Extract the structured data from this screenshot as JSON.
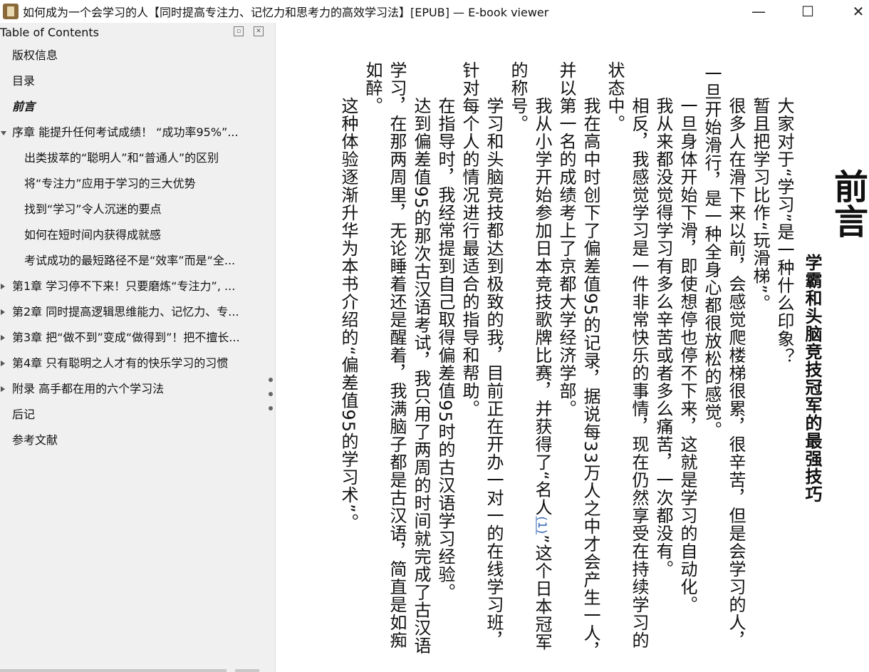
{
  "window": {
    "title": "如何成为一个会学习的人【同时提高专注力、记忆力和思考力的高效学习法】[EPUB] — E-book viewer",
    "minimize": "—",
    "maximize": "☐",
    "close": "✕"
  },
  "toc": {
    "title": "Table of Contents",
    "float_btn": "▫",
    "close_btn": "✕",
    "items": [
      {
        "label": "版权信息"
      },
      {
        "label": "目录"
      },
      {
        "label": "前言"
      },
      {
        "label": "序章 能提升任何考试成绩！ “成功率95%”..."
      },
      {
        "label": "出类拔萃的“聪明人”和“普通人”的区别"
      },
      {
        "label": "将“专注力”应用于学习的三大优势"
      },
      {
        "label": "找到“学习”令人沉迷的要点"
      },
      {
        "label": "如何在短时间内获得成就感"
      },
      {
        "label": "考试成功的最短路径不是“效率”而是“全..."
      },
      {
        "label": "第1章 学习停不下来！只要磨炼“专注力”, ..."
      },
      {
        "label": "第2章 同时提高逻辑思维能力、记忆力、专..."
      },
      {
        "label": "第3章 把“做不到”变成“做得到”！把不擅长..."
      },
      {
        "label": "第4章 只有聪明之人才有的快乐学习的习惯"
      },
      {
        "label": "附录 高手都在用的六个学习法"
      },
      {
        "label": "后记"
      },
      {
        "label": "参考文献"
      }
    ]
  },
  "book": {
    "chapter_title": "前言",
    "subtitle": "学霸和头脑竞技冠军的最强技巧",
    "columns": [
      "大家对于“学习”是一种什么印象？",
      "暂且把学习比作“玩滑梯”。",
      "很多人在滑下来以前，会感觉爬楼梯很累，很辛苦，但是会学习的人，",
      "一旦开始滑行，是一种全身心都很放松的感觉。",
      "一旦身体开始下滑，即使想停也停不下来，这就是学习的自动化。",
      "我从来都没觉得学习有多么辛苦或者多么痛苦，一次都没有。",
      "相反，我感觉学习是一件非常快乐的事情，现在仍然享受在持续学习的",
      "状态中。",
      "我在高中时创下了偏差值95的记录，据说每33万人之中才会产生一人，",
      "并以第一名的成绩考上了京都大学经济学部。",
      "我从小学开始参加日本竞技歌牌比赛，并获得了“名人",
      "的称号。",
      "学习和头脑竞技都达到极致的我，目前正在开办一对一的在线学习班，",
      "针对每个人的情况进行最适合的指导和帮助。",
      "在指导时，我经常提到自己取得偏差值95时的古汉语学习经验。",
      "达到偏差值95的那次古汉语考试，我只用了两周的时间就完成了古汉语",
      "学习，在那两周里，无论睡着还是醒着，我满脑子都是古汉语，简直是如痴",
      "如醉。",
      "这种体验逐渐升华为本书介绍的“偏差值95的学习术”。"
    ],
    "footnote_ref": "(1)",
    "col10_tail": "”这个日本冠军"
  }
}
